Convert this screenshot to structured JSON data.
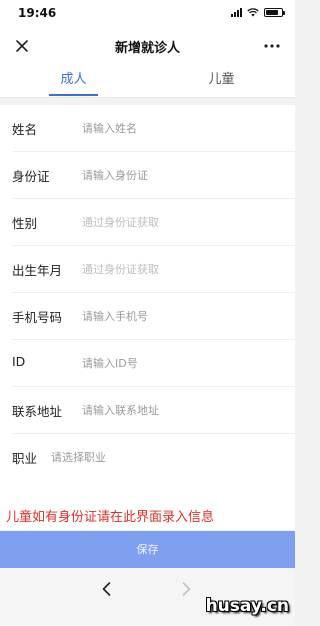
{
  "status_bar": {
    "time": "19:46"
  },
  "nav_bar": {
    "title": "新增就诊人"
  },
  "tabs": [
    {
      "label": "成人",
      "active": true
    },
    {
      "label": "儿童",
      "active": false
    }
  ],
  "form": {
    "fields": [
      {
        "label": "姓名",
        "placeholder": "请输入姓名"
      },
      {
        "label": "身份证",
        "placeholder": "请输入身份证"
      },
      {
        "label": "性别",
        "placeholder": "通过身份证获取"
      },
      {
        "label": "出生年月",
        "placeholder": "通过身份证获取"
      },
      {
        "label": "手机号码",
        "placeholder": "请输入手机号"
      },
      {
        "label": "ID",
        "placeholder": "请输入ID号"
      },
      {
        "label": "联系地址",
        "placeholder": "请输入联系地址"
      },
      {
        "label": "职业",
        "placeholder": "请选择职业"
      }
    ]
  },
  "notice": "儿童如有身份证请在此界面录入信息",
  "save_label": "保存",
  "watermark": "husay.cn",
  "colors": {
    "accent": "#3b6fd6",
    "save_button": "#7f9ff0",
    "notice": "#e0302a"
  }
}
